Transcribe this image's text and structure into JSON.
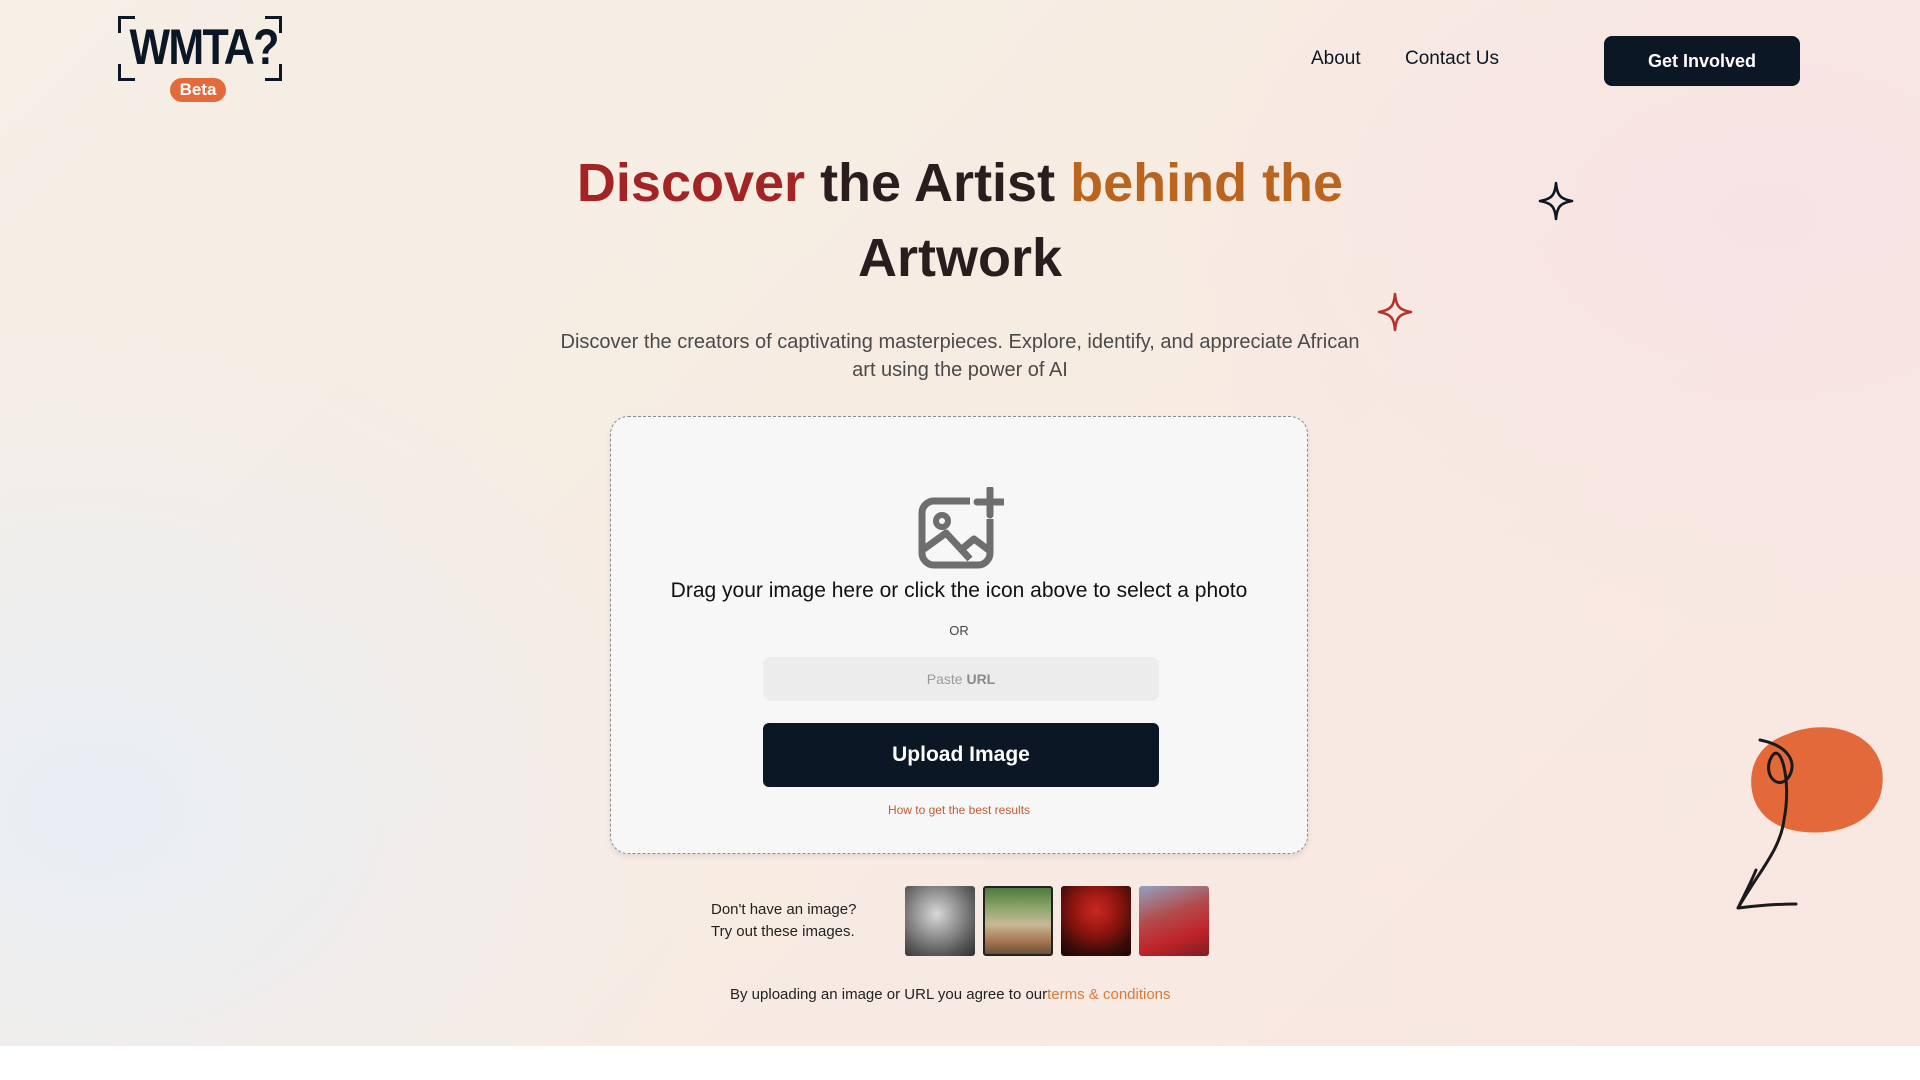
{
  "brand": {
    "logo_text": "WMTA?",
    "badge": "Beta"
  },
  "nav": {
    "about": "About",
    "contact": "Contact Us",
    "cta": "Get Involved"
  },
  "hero": {
    "title_part1": "Discover",
    "title_part2": "the Artist",
    "title_part3": "behind the",
    "title_part4": "Artwork",
    "subtitle": "Discover the creators of captivating masterpieces. Explore, identify, and appreciate African art using the power of AI"
  },
  "upload": {
    "drag_text": "Drag your image here or click the icon above to select a photo",
    "or_text": "OR",
    "url_placeholder_prefix": "Paste",
    "url_placeholder_strong": "URL",
    "button": "Upload Image",
    "help_link": "How to get the best results"
  },
  "samples": {
    "line1": "Don't have an image?",
    "line2": "Try out these images."
  },
  "terms": {
    "text": "By uploading an image or URL you agree to our",
    "link": "terms & conditions"
  },
  "colors": {
    "navy": "#0c1726",
    "title_red": "#a32425",
    "title_orange": "#b9651f",
    "accent_orange": "#e36a3b",
    "link_orange": "#d87a3c"
  },
  "icons": [
    "add-image-icon",
    "sparkle-icon",
    "arrow-blob-decoration"
  ]
}
